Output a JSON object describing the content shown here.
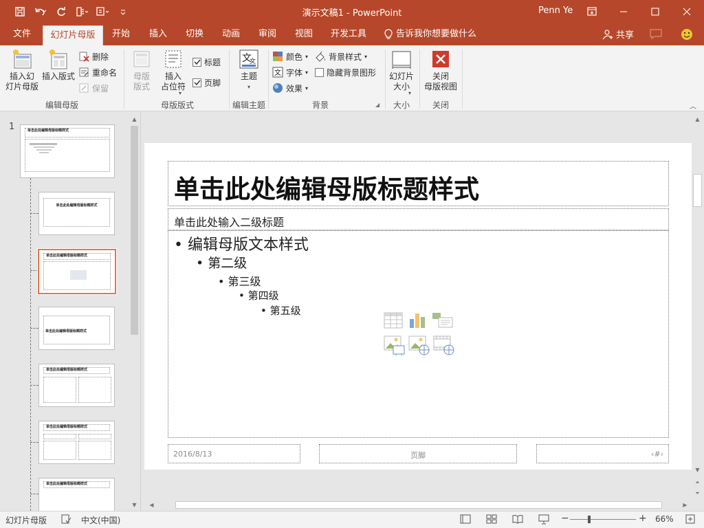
{
  "window": {
    "title": "演示文稿1 - PowerPoint",
    "user": "Penn Ye"
  },
  "tabs": [
    {
      "label": "文件"
    },
    {
      "label": "幻灯片母版"
    },
    {
      "label": "开始"
    },
    {
      "label": "插入"
    },
    {
      "label": "切换"
    },
    {
      "label": "动画"
    },
    {
      "label": "审阅"
    },
    {
      "label": "视图"
    },
    {
      "label": "开发工具"
    }
  ],
  "tell_me": "告诉我你想要做什么",
  "share": "共享",
  "ribbon": {
    "edit_master": {
      "label": "编辑母版",
      "insert_slide_master": "插入幻\n灯片母版",
      "insert_layout": "插入版式",
      "delete": "删除",
      "rename": "重命名",
      "preserve": "保留"
    },
    "master_layout": {
      "label": "母版版式",
      "master_layout_btn": "母版\n版式",
      "insert_placeholder": "插入\n占位符",
      "title_check": "标题",
      "footer_check": "页脚"
    },
    "edit_theme": {
      "label": "编辑主题",
      "themes": "主题"
    },
    "background": {
      "label": "背景",
      "colors": "颜色",
      "fonts": "字体",
      "effects": "效果",
      "bg_styles": "背景样式",
      "hide_bg": "隐藏背景图形"
    },
    "size": {
      "label": "大小",
      "slide_size": "幻灯片\n大小"
    },
    "close": {
      "label": "关闭",
      "close_master": "关闭\n母版视图"
    }
  },
  "thumbnails": {
    "number": "1",
    "items": [
      {
        "title": "单击此处编辑母版标题样式"
      },
      {
        "title": "单击此处编辑母版标题样式"
      },
      {
        "title": "单击此处编辑母版标题样式"
      },
      {
        "title": "单击此处编辑母版标题样式"
      },
      {
        "title": "单击此处编辑母版标题样式"
      },
      {
        "title": "单击此处编辑母版标题样式"
      },
      {
        "title": "单击此处编辑母版标题样式"
      }
    ]
  },
  "slide": {
    "title": "单击此处编辑母版标题样式",
    "subtitle": "单击此处输入二级标题",
    "levels": [
      "编辑母版文本样式",
      "第二级",
      "第三级",
      "第四级",
      "第五级"
    ],
    "footer_date": "2016/8/13",
    "footer_text": "页脚",
    "footer_num": "‹#›"
  },
  "status": {
    "view": "幻灯片母版",
    "language": "中文(中国)",
    "zoom": "66%"
  },
  "colors": {
    "accent": "#b7472a",
    "selection": "#e9734f"
  }
}
